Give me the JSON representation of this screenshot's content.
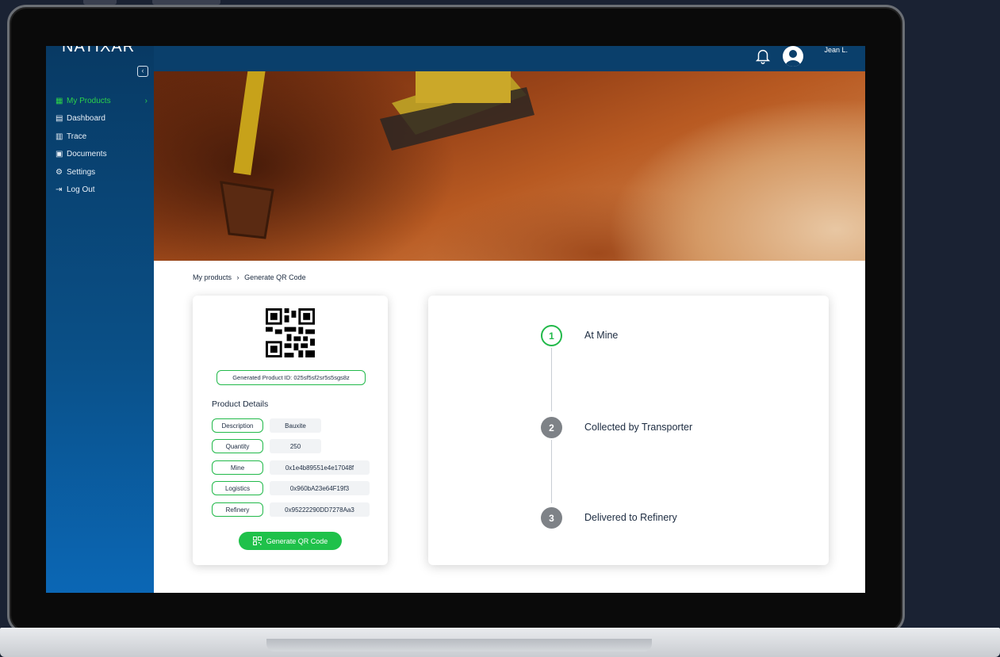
{
  "app": {
    "logo": "NATIXAR"
  },
  "header": {
    "user_name": "Jean L."
  },
  "sidebar": {
    "items": [
      {
        "label": "My Products",
        "icon": "grid-icon",
        "active": true
      },
      {
        "label": "Dashboard",
        "icon": "dashboard-icon"
      },
      {
        "label": "Trace",
        "icon": "trace-icon"
      },
      {
        "label": "Documents",
        "icon": "document-icon"
      },
      {
        "label": "Settings",
        "icon": "gear-icon"
      },
      {
        "label": "Log Out",
        "icon": "logout-icon"
      }
    ]
  },
  "breadcrumb": {
    "parent": "My products",
    "separator": "›",
    "current": "Generate QR Code"
  },
  "product": {
    "generated_id_text": "Generated Product ID: 025sf5sf2sr5s5sgs8z",
    "details_title": "Product Details",
    "fields": [
      {
        "key": "Description",
        "value": "Bauxite"
      },
      {
        "key": "Quantity",
        "value": "250"
      },
      {
        "key": "Mine",
        "value": "0x1e4b89551e4e17048f"
      },
      {
        "key": "Logistics",
        "value": "0x960bA23e64F19f3"
      },
      {
        "key": "Refinery",
        "value": "0x95222290DD7278Aa3"
      }
    ],
    "generate_button": "Generate QR Code"
  },
  "steps": [
    {
      "number": "1",
      "label": "At Mine",
      "state": "active"
    },
    {
      "number": "2",
      "label": "Collected by Transporter",
      "state": "pending"
    },
    {
      "number": "3",
      "label": "Delivered to Refinery",
      "state": "pending"
    }
  ],
  "colors": {
    "accent": "#22b94a",
    "sidebar": "#0a4f86",
    "topbar": "#0a3f6b"
  }
}
